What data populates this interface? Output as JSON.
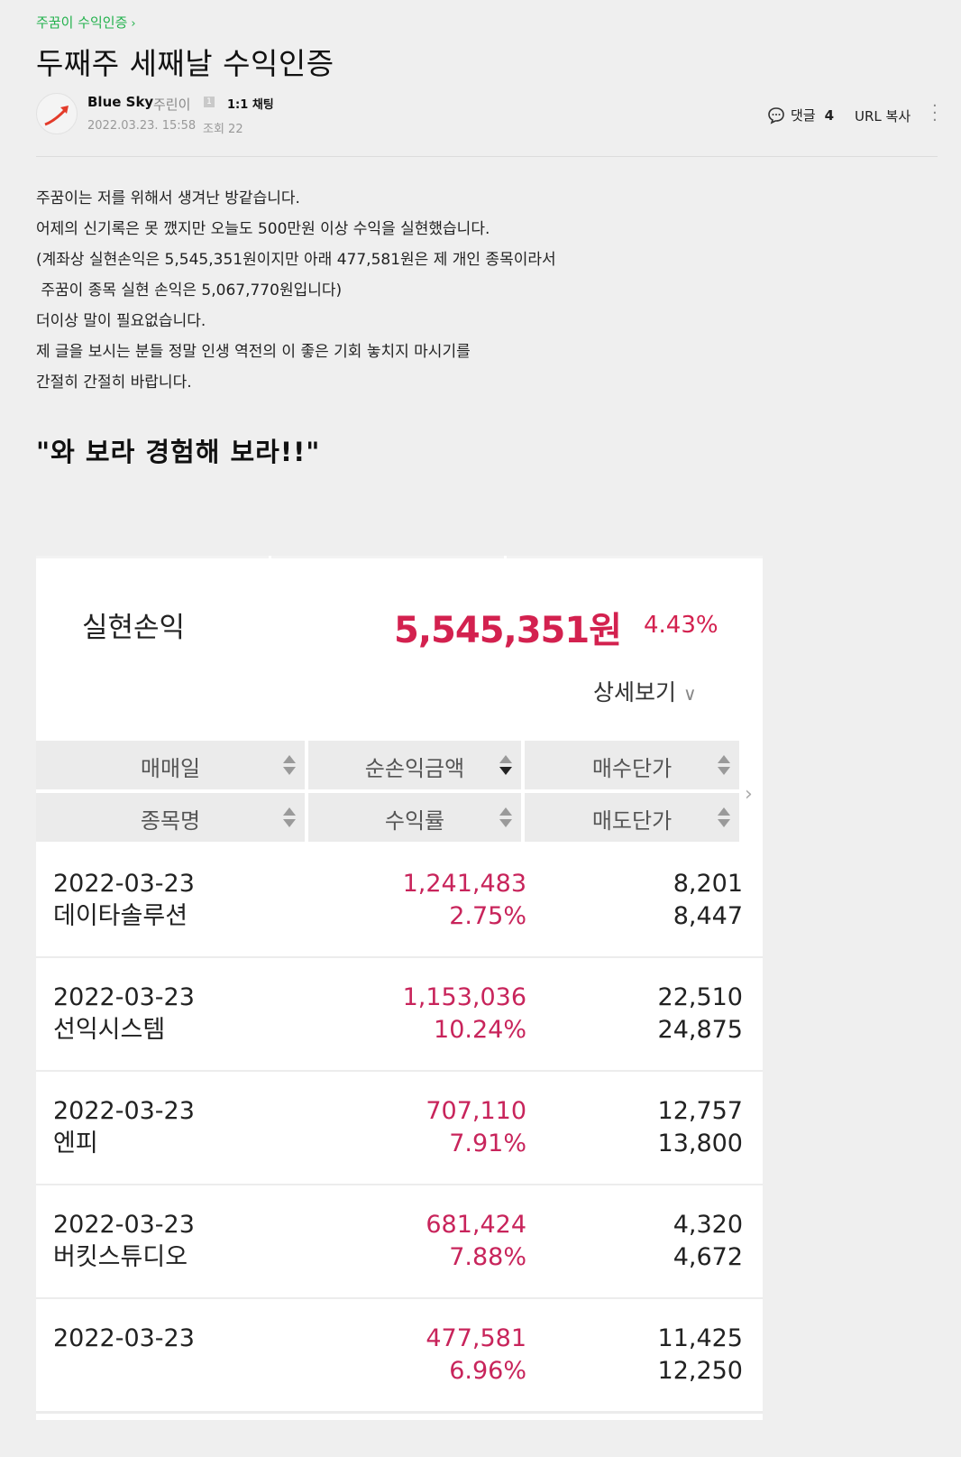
{
  "breadcrumb": {
    "category": "주꿈이 수익인증",
    "chevron": "›"
  },
  "post": {
    "title": "두째주 세째날 수익인증",
    "author": "Blue Sky",
    "grade": "주린이",
    "grade_badge": "1",
    "chat": "1:1 채팅",
    "date": "2022.03.23. 15:58",
    "views": "조회 22",
    "comments_label": "댓글",
    "comments_count": "4",
    "url_copy": "URL 복사",
    "body_lines": [
      "주꿈이는 저를 위해서 생겨난 방같습니다.",
      "어제의 신기록은 못 깼지만 오늘도 500만원 이상 수익을 실현했습니다.",
      "(계좌상 실현손익은 5,545,351원이지만 아래 477,581원은 제 개인 종목이라서",
      " 주꿈이 종목 실현 손익은 5,067,770원입니다)",
      "더이상 말이 필요없습니다.",
      "제 글을 보시는 분들 정말 인생 역전의 이 좋은 기회 놓치지 마시기를",
      "간절히 간절히 바랍니다."
    ],
    "quote": "\"와 보라 경험해 보라!!\""
  },
  "profit_card": {
    "label": "실현손익",
    "value": "5,545,351원",
    "percent": "4.43%",
    "detail": "상세보기",
    "headers": {
      "row1": [
        "매매일",
        "순손익금액",
        "매수단가"
      ],
      "row2": [
        "종목명",
        "수익률",
        "매도단가"
      ]
    },
    "rows": [
      {
        "date": "2022-03-23",
        "name": "데이타솔루션",
        "profit": "1,241,483",
        "rate": "2.75%",
        "buy": "8,201",
        "sell": "8,447"
      },
      {
        "date": "2022-03-23",
        "name": "선익시스템",
        "profit": "1,153,036",
        "rate": "10.24%",
        "buy": "22,510",
        "sell": "24,875"
      },
      {
        "date": "2022-03-23",
        "name": "엔피",
        "profit": "707,110",
        "rate": "7.91%",
        "buy": "12,757",
        "sell": "13,800"
      },
      {
        "date": "2022-03-23",
        "name": "버킷스튜디오",
        "profit": "681,424",
        "rate": "7.88%",
        "buy": "4,320",
        "sell": "4,672"
      },
      {
        "date": "2022-03-23",
        "name": "",
        "profit": "477,581",
        "rate": "6.96%",
        "buy": "11,425",
        "sell": "12,250"
      }
    ]
  },
  "colors": {
    "accent_green": "#22b14c",
    "profit_red": "#d3214f",
    "row_red": "#c8245b"
  }
}
